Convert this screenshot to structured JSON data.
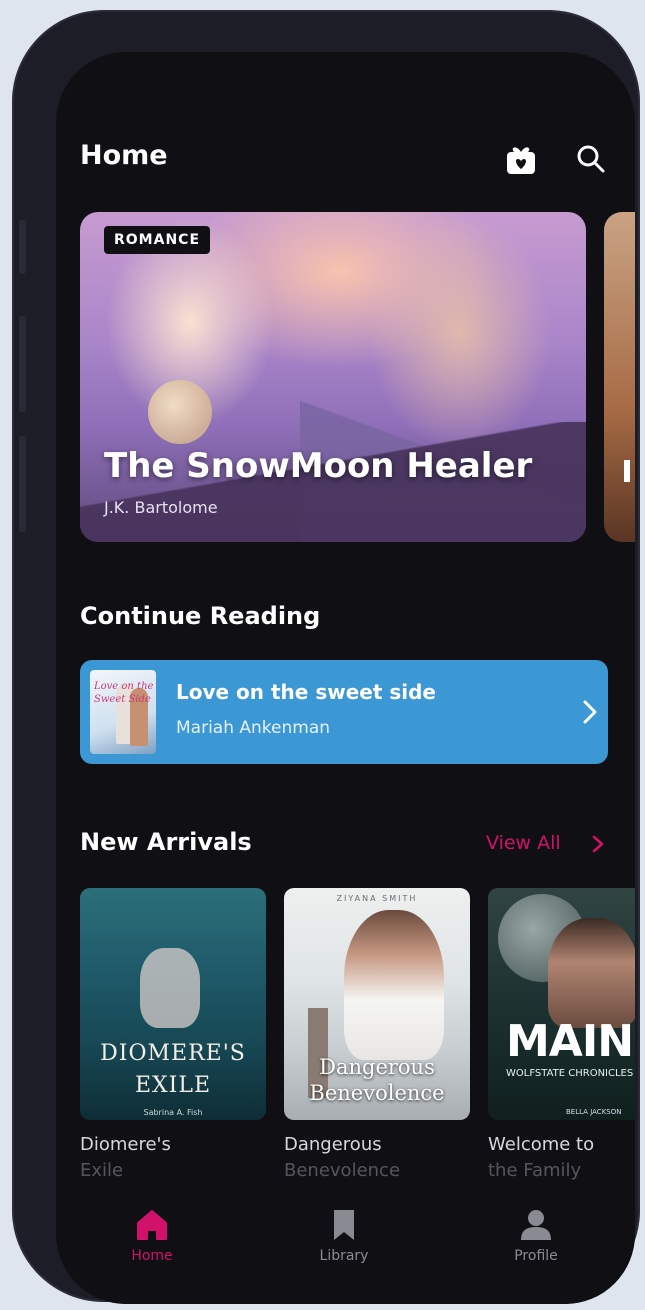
{
  "header": {
    "title": "Home"
  },
  "hero": {
    "tag": "ROMANCE",
    "title": "The SnowMoon Healer",
    "author": "J.K. Bartolome"
  },
  "continue_reading": {
    "section_title": "Continue Reading",
    "book_title": "Love on the sweet side",
    "author": "Mariah Ankenman",
    "cover_text": "Love on the Sweet Side"
  },
  "new_arrivals": {
    "section_title": "New Arrivals",
    "view_all": "View All",
    "books": [
      {
        "cover_title": "DIOMERE'S EXILE",
        "cover_author": "Sabrina A. Fish",
        "label_line1": "Diomere's",
        "label_line2": "Exile"
      },
      {
        "cover_title": "Dangerous Benevolence",
        "cover_author": "ZIYANA SMITH",
        "label_line1": "Dangerous",
        "label_line2": "Benevolence"
      },
      {
        "cover_title": "MAINE",
        "cover_subtitle": "WOLFSTATE CHRONICLES",
        "cover_author": "BELLA JACKSON",
        "label_line1": "Welcome to",
        "label_line2": "the Family"
      }
    ]
  },
  "nav": {
    "items": [
      {
        "label": "Home",
        "icon": "home-icon",
        "active": true
      },
      {
        "label": "Library",
        "icon": "bookmark-icon",
        "active": false
      },
      {
        "label": "Profile",
        "icon": "person-icon",
        "active": false
      }
    ]
  },
  "colors": {
    "background": "#101014",
    "accent": "#d0126b",
    "continue_card": "#3c97d5",
    "inactive": "#8a8a93"
  }
}
